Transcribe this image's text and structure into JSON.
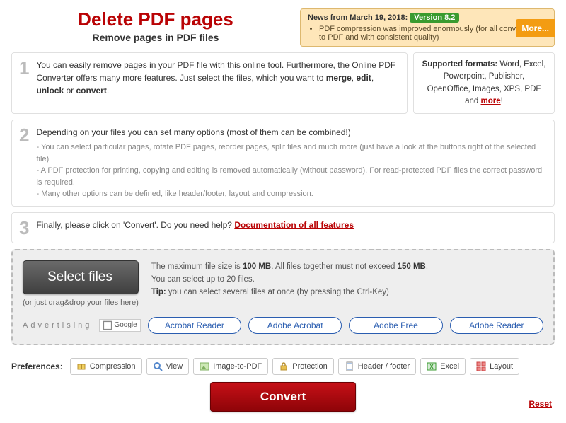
{
  "header": {
    "title": "Delete PDF pages",
    "subtitle": "Remove pages in PDF files"
  },
  "news": {
    "prefix": "News from March 19, 2018:",
    "version": "Version 8.2",
    "item": "PDF compression was improved enormously (for all conversions to PDF and with consistent quality)",
    "more": "More..."
  },
  "steps": {
    "s1": {
      "num": "1",
      "text_a": "You can easily remove pages in your PDF file with this online tool. Furthermore, the Online PDF Converter offers many more features. Just select the files, which you want to ",
      "b1": "merge",
      "c1": ", ",
      "b2": "edit",
      "c2": ", ",
      "b3": "unlock",
      "c3": " or ",
      "b4": "convert",
      "c4": "."
    },
    "formats": {
      "label": "Supported formats:",
      "list": " Word, Excel, Powerpoint, Publisher, OpenOffice, Images, XPS, PDF and ",
      "more": "more",
      "bang": "!"
    },
    "s2": {
      "num": "2",
      "lead": "Depending on your files you can set many options (most of them can be combined!)",
      "n1": "- You can select particular pages, rotate PDF pages, reorder pages, split files and much more (just have a look at the buttons right of the selected file)",
      "n2": "- A PDF protection for printing, copying and editing is removed automatically (without password). For read-protected PDF files the correct password is required.",
      "n3": "- Many other options can be defined, like header/footer, layout and compression."
    },
    "s3": {
      "num": "3",
      "text": "Finally, please click on 'Convert'. Do you need help? ",
      "doc": "Documentation of all features"
    }
  },
  "upload": {
    "select": "Select files",
    "drag": "(or just drag&drop your files here)",
    "info1a": "The maximum file size is ",
    "info1b": "100 MB",
    "info1c": ". All files together must not exceed ",
    "info1d": "150 MB",
    "info1e": ".",
    "info2": "You can select up to 20 files.",
    "tipLabel": "Tip:",
    "tipText": " you can select several files at once (by pressing the Ctrl-Key)"
  },
  "ads": {
    "label": "Advertising",
    "google": "Google",
    "a1": "Acrobat Reader",
    "a2": "Adobe Acrobat",
    "a3": "Adobe Free",
    "a4": "Adobe Reader"
  },
  "prefs": {
    "label": "Preferences:",
    "compression": "Compression",
    "view": "View",
    "img2pdf": "Image-to-PDF",
    "protection": "Protection",
    "headerfooter": "Header / footer",
    "excel": "Excel",
    "layout": "Layout"
  },
  "actions": {
    "convert": "Convert",
    "reset": "Reset"
  }
}
